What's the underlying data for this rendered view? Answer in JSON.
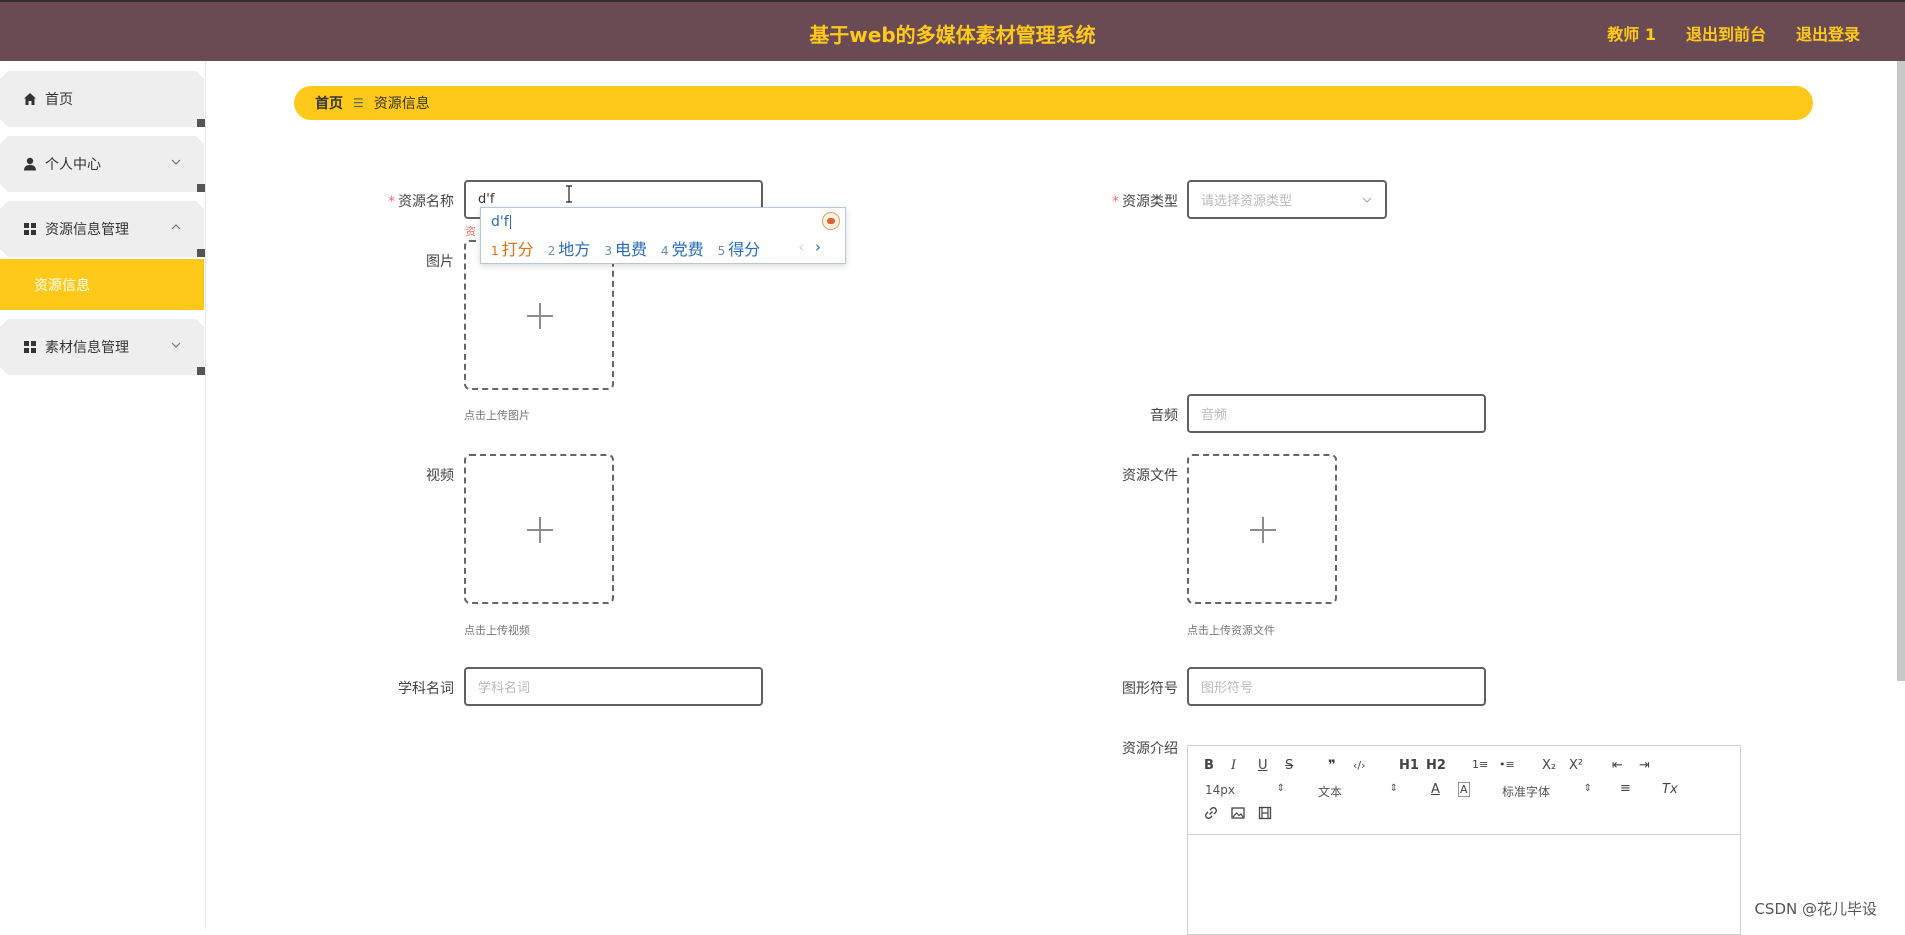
{
  "header": {
    "title": "基于web的多媒体素材管理系统",
    "nav": [
      "教师 1",
      "退出到前台",
      "退出登录"
    ]
  },
  "sidebar": {
    "items": [
      {
        "label": "首页",
        "icon": "home-icon"
      },
      {
        "label": "个人中心",
        "icon": "user-icon",
        "caret": "down"
      },
      {
        "label": "资源信息管理",
        "icon": "grid-icon",
        "caret": "up"
      },
      {
        "label": "素材信息管理",
        "icon": "grid-icon",
        "caret": "down"
      }
    ],
    "active_sub": "资源信息"
  },
  "breadcrumb": {
    "home": "首页",
    "separator": "☰",
    "current": "资源信息"
  },
  "form": {
    "resource_name": {
      "label": "资源名称",
      "value": "d'f",
      "error": "资"
    },
    "resource_type": {
      "label": "资源类型",
      "placeholder": "请选择资源类型"
    },
    "image": {
      "label": "图片",
      "hint": "点击上传图片"
    },
    "audio": {
      "label": "音频",
      "placeholder": "音频"
    },
    "video": {
      "label": "视频",
      "hint": "点击上传视频"
    },
    "resource_file": {
      "label": "资源文件",
      "hint": "点击上传资源文件"
    },
    "subject_term": {
      "label": "学科名词",
      "placeholder": "学科名词"
    },
    "graphic_symbol": {
      "label": "图形符号",
      "placeholder": "图形符号"
    },
    "resource_intro": {
      "label": "资源介绍"
    }
  },
  "ime": {
    "composition": "d'f",
    "candidates": [
      {
        "num": "1",
        "text": "打分"
      },
      {
        "num": "2",
        "text": "地方"
      },
      {
        "num": "3",
        "text": "电费"
      },
      {
        "num": "4",
        "text": "党费"
      },
      {
        "num": "5",
        "text": "得分"
      }
    ],
    "prev": "‹",
    "next": "›"
  },
  "editor": {
    "buttons": [
      "B",
      "I",
      "U",
      "S",
      "❞",
      "‹/›",
      "H1",
      "H2",
      "1≡",
      "•≡",
      "X₂",
      "X²",
      "⇤",
      "⇥"
    ],
    "font_size": "14px",
    "block_type": "文本",
    "font_family": "标准字体",
    "color_btn": "A",
    "bg_btn": "A",
    "align_btn": "≡",
    "clear_btn": "Tx"
  },
  "watermark": "CSDN @花儿毕设"
}
